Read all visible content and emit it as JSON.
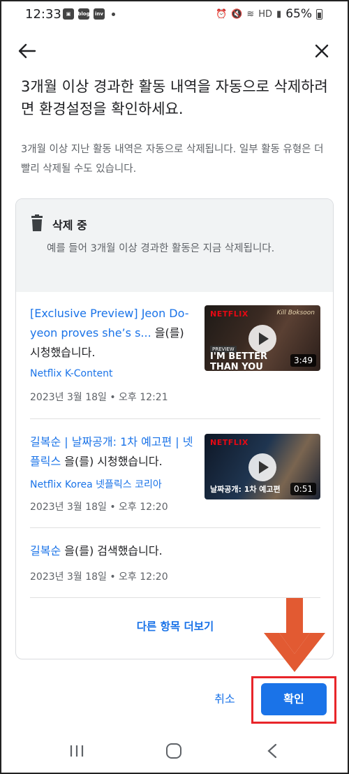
{
  "status_bar": {
    "time": "12:33",
    "left_icons": [
      "image-icon",
      "blog-icon",
      "inv-icon"
    ],
    "blog_label": "blog",
    "inv_label": "inv",
    "hd_label": "HD",
    "battery": "65%"
  },
  "dialog": {
    "heading": "3개월 이상 경과한 활동 내역을 자동으로 삭제하려면 환경설정을 확인하세요.",
    "subtext": "3개월 이상 지난 활동 내역은 자동으로 삭제됩니다. 일부 활동 유형은 더 빨리 삭제될 수도 있습니다.",
    "card": {
      "title": "삭제 중",
      "desc": "예를 들어 3개월 이상 경과한 활동은 지금 삭제됩니다.",
      "items": [
        {
          "link": "[Exclusive Preview] Jeon Do-yeon proves she’s s...",
          "suffix": "을(를) 시청했습니다.",
          "channel": "Netflix K-Content",
          "date": "2023년 3월 18일 • 오후 12:21",
          "thumb": {
            "logo": "NETFLIX",
            "script": "Kill Boksoon",
            "tag": "PREVIEW",
            "caption": "I'M BETTER THAN YOU",
            "duration": "3:49"
          }
        },
        {
          "link": "길복순 | 날짜공개: 1차 예고편 | 넷플릭스",
          "suffix": " 을(를) 시청했습니다.",
          "channel": "Netflix Korea 넷플릭스 코리아",
          "date": "2023년 3월 18일 • 오후 12:20",
          "thumb": {
            "logo": "NETFLIX",
            "caption": "날짜공개: 1차 예고편",
            "duration": "0:51"
          }
        },
        {
          "link": "길복순",
          "suffix": " 을(를) 검색했습니다.",
          "date": "2023년 3월 18일 • 오후 12:20"
        }
      ],
      "more": "다른 항목 더보기"
    },
    "cancel_label": "취소",
    "confirm_label": "확인"
  },
  "colors": {
    "accent": "#1a73e8",
    "annotation": "#e25a32",
    "highlight": "#e8252a"
  }
}
